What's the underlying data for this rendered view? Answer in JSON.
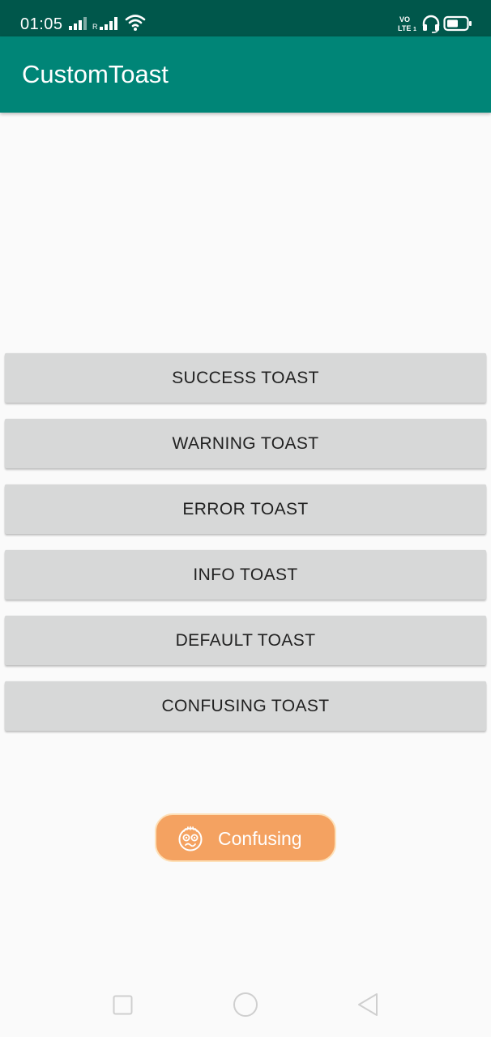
{
  "status_bar": {
    "time": "01:05",
    "icons": [
      "signal-icon",
      "roaming-signal-icon",
      "wifi-icon",
      "volte-icon",
      "headset-icon",
      "battery-icon"
    ]
  },
  "app_bar": {
    "title": "CustomToast",
    "color": "#008577"
  },
  "buttons": [
    {
      "label": "SUCCESS TOAST"
    },
    {
      "label": "WARNING TOAST"
    },
    {
      "label": "ERROR TOAST"
    },
    {
      "label": "INFO TOAST"
    },
    {
      "label": "DEFAULT TOAST"
    },
    {
      "label": "CONFUSING TOAST"
    }
  ],
  "toast": {
    "text": "Confusing",
    "icon": "confused-face-icon",
    "color": "#f4a261"
  },
  "nav_bar": {
    "icons": [
      "recents-square-icon",
      "home-circle-icon",
      "back-triangle-icon"
    ]
  }
}
